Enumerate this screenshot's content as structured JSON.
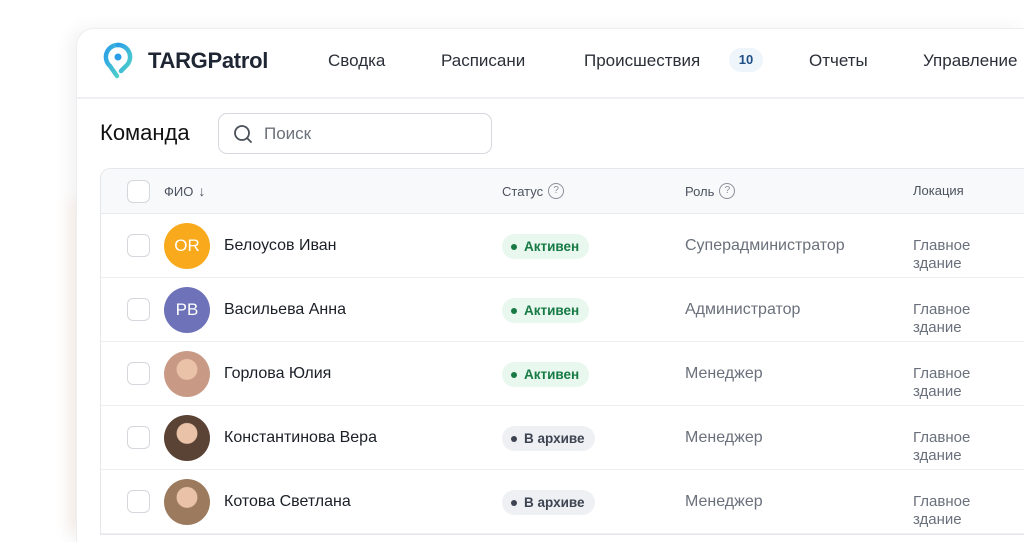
{
  "brand": "TARGPatrol",
  "nav": [
    {
      "label": "Сводка"
    },
    {
      "label": "Расписани"
    },
    {
      "label": "Происшествия",
      "badge": "10"
    },
    {
      "label": "Отчеты"
    },
    {
      "label": "Управление"
    }
  ],
  "page_title": "Команда",
  "search": {
    "placeholder": "Поиск"
  },
  "columns": {
    "name": "ФИО",
    "status": "Статус",
    "role": "Роль",
    "location": "Локация"
  },
  "colors": {
    "active_bg": "#e9f8ef",
    "active_fg": "#177a45",
    "archived_bg": "#eef0f3",
    "archived_fg": "#3d4350"
  },
  "rows": [
    {
      "initials": "OR",
      "avatar_color": "#f8aa1c",
      "name": "Белоусов Иван",
      "status": "Активен",
      "status_type": "active",
      "role": "Суперадминистратор",
      "location": "Главное здание"
    },
    {
      "initials": "PB",
      "avatar_color": "#6e72b8",
      "name": "Васильева Анна",
      "status": "Активен",
      "status_type": "active",
      "role": "Администратор",
      "location": "Главное здание"
    },
    {
      "initials": "",
      "avatar_color": "#c89a86",
      "name": "Горлова Юлия",
      "status": "Активен",
      "status_type": "active",
      "role": "Менеджер",
      "location": "Главное здание"
    },
    {
      "initials": "",
      "avatar_color": "#5a4335",
      "name": "Константинова Вера",
      "status": "В архиве",
      "status_type": "archived",
      "role": "Менеджер",
      "location": "Главное здание"
    },
    {
      "initials": "",
      "avatar_color": "#9c7a5e",
      "name": "Котова Светлана",
      "status": "В архиве",
      "status_type": "archived",
      "role": "Менеджер",
      "location": "Главное здание"
    }
  ]
}
